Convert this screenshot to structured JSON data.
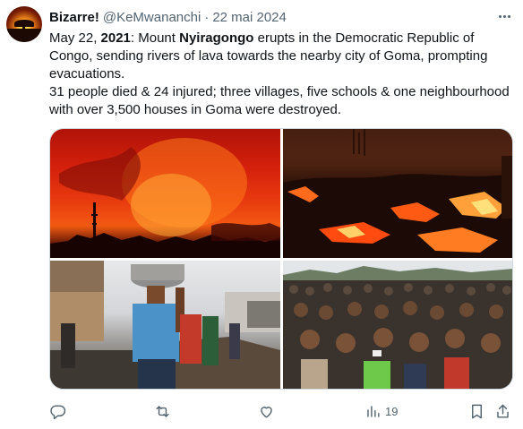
{
  "tweet": {
    "display_name": "Bizarre!",
    "handle": "@KeMwananchi",
    "separator": "·",
    "date": "22 mai 2024",
    "body": {
      "line1_pre": "May 22, ",
      "line1_year": "2021",
      "line1_mid": ": Mount ",
      "line1_volcano": "Nyiragongo",
      "line1_post": " erupts in the Democratic Republic of Congo, sending rivers of lava towards the nearby city of Goma, prompting evacuations.",
      "line2": "31 people died & 24 injured; three villages, five schools & one neighbourhood with over 3,500 houses in Goma were destroyed."
    },
    "media": [
      {
        "icon": "volcano-eruption-photo"
      },
      {
        "icon": "lava-flow-photo"
      },
      {
        "icon": "evacuee-carrying-basin-photo"
      },
      {
        "icon": "crowd-of-evacuees-photo"
      }
    ],
    "actions": {
      "reply": {
        "icon": "reply-icon"
      },
      "retweet": {
        "icon": "retweet-icon"
      },
      "like": {
        "icon": "heart-icon"
      },
      "views": {
        "icon": "views-icon",
        "count": "19"
      },
      "bookmark": {
        "icon": "bookmark-icon"
      },
      "share": {
        "icon": "share-icon"
      }
    }
  }
}
